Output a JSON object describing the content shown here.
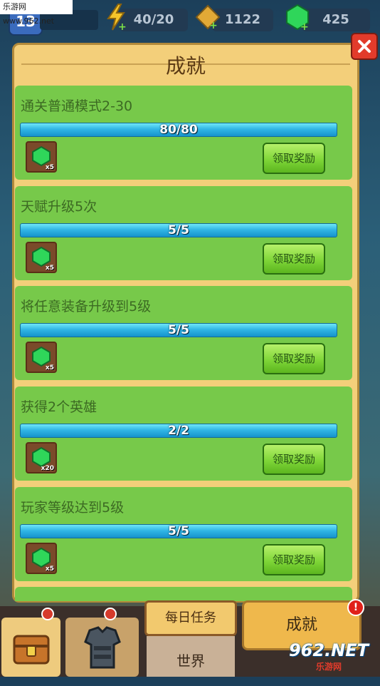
{
  "watermark": "乐游网 www.962.net",
  "top": {
    "level": "13",
    "energy": "40/20",
    "gold": "1122",
    "gems": "425"
  },
  "panel": {
    "title": "成就",
    "close_label": "✕"
  },
  "achievements": [
    {
      "title": "通关普通模式2-30",
      "progress": "80/80",
      "progress_fraction": 1.0,
      "reward_count": "x5",
      "claim_label": "领取奖励"
    },
    {
      "title": "天赋升级5次",
      "progress": "5/5",
      "progress_fraction": 1.0,
      "reward_count": "x5",
      "claim_label": "领取奖励"
    },
    {
      "title": "将任意装备升级到5级",
      "progress": "5/5",
      "progress_fraction": 1.0,
      "reward_count": "x5",
      "claim_label": "领取奖励"
    },
    {
      "title": "获得2个英雄",
      "progress": "2/2",
      "progress_fraction": 1.0,
      "reward_count": "x20",
      "claim_label": "领取奖励"
    },
    {
      "title": "玩家等级达到5级",
      "progress": "5/5",
      "progress_fraction": 1.0,
      "reward_count": "x5",
      "claim_label": "领取奖励"
    }
  ],
  "bottom": {
    "daily_tab": "每日任务",
    "world_tab": "世界",
    "achievements_tab": "成就",
    "alert": "!",
    "logo_main": "962.NET",
    "logo_sub": "乐游网"
  },
  "colors": {
    "card": "#77c94a",
    "progress": "#31b6e5",
    "claim": "#7fd638",
    "gem": "#2fd65a"
  }
}
